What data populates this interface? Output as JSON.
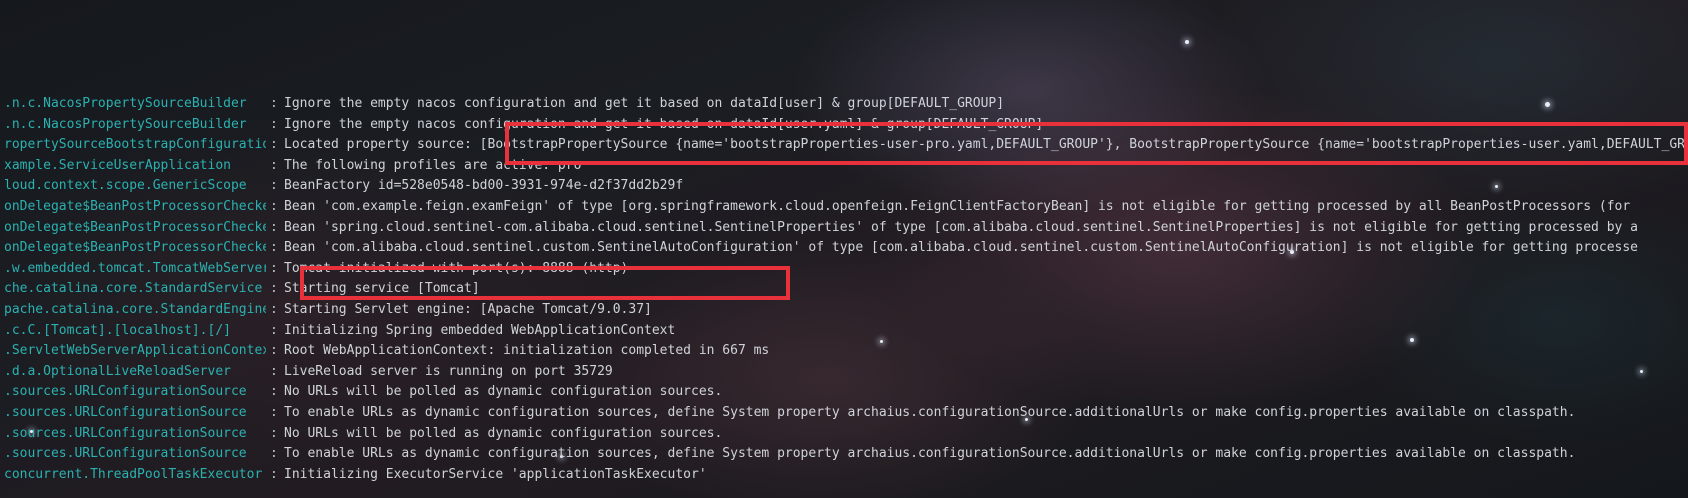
{
  "console": {
    "lines": [
      {
        "logger": ".n.c.NacosPropertySourceBuilder",
        "message": "Ignore the empty nacos configuration and get it based on dataId[user] & group[DEFAULT_GROUP]"
      },
      {
        "logger": ".n.c.NacosPropertySourceBuilder",
        "message": "Ignore the empty nacos configuration and get it based on dataId[user.yaml] & group[DEFAULT_GROUP]"
      },
      {
        "logger": "ropertySourceBootstrapConfiguration",
        "message": "Located property source: [BootstrapPropertySource {name='bootstrapProperties-user-pro.yaml,DEFAULT_GROUP'}, BootstrapPropertySource {name='bootstrapProperties-user.yaml,DEFAULT_GROUP'}"
      },
      {
        "logger": "xample.ServiceUserApplication",
        "message": "The following profiles are active: pro"
      },
      {
        "logger": "loud.context.scope.GenericScope",
        "message": "BeanFactory id=528e0548-bd00-3931-974e-d2f37dd2b29f"
      },
      {
        "logger": "onDelegate$BeanPostProcessorChecker",
        "message": "Bean 'com.example.feign.examFeign' of type [org.springframework.cloud.openfeign.FeignClientFactoryBean] is not eligible for getting processed by all BeanPostProcessors (for"
      },
      {
        "logger": "onDelegate$BeanPostProcessorChecker",
        "message": "Bean 'spring.cloud.sentinel-com.alibaba.cloud.sentinel.SentinelProperties' of type [com.alibaba.cloud.sentinel.SentinelProperties] is not eligible for getting processed by a"
      },
      {
        "logger": "onDelegate$BeanPostProcessorChecker",
        "message": "Bean 'com.alibaba.cloud.sentinel.custom.SentinelAutoConfiguration' of type [com.alibaba.cloud.sentinel.custom.SentinelAutoConfiguration] is not eligible for getting processe"
      },
      {
        "logger": ".w.embedded.tomcat.TomcatWebServer",
        "message": "Tomcat initialized with port(s): 8888 (http)"
      },
      {
        "logger": "che.catalina.core.StandardService",
        "message": "Starting service [Tomcat]"
      },
      {
        "logger": "pache.catalina.core.StandardEngine",
        "message": "Starting Servlet engine: [Apache Tomcat/9.0.37]"
      },
      {
        "logger": ".c.C.[Tomcat].[localhost].[/]",
        "message": "Initializing Spring embedded WebApplicationContext"
      },
      {
        "logger": ".ServletWebServerApplicationContext",
        "message": "Root WebApplicationContext: initialization completed in 667 ms"
      },
      {
        "logger": ".d.a.OptionalLiveReloadServer",
        "message": "LiveReload server is running on port 35729"
      },
      {
        "logger": ".sources.URLConfigurationSource",
        "message": "No URLs will be polled as dynamic configuration sources."
      },
      {
        "logger": ".sources.URLConfigurationSource",
        "message": "To enable URLs as dynamic configuration sources, define System property archaius.configurationSource.additionalUrls or make config.properties available on classpath."
      },
      {
        "logger": ".sources.URLConfigurationSource",
        "message": "No URLs will be polled as dynamic configuration sources."
      },
      {
        "logger": ".sources.URLConfigurationSource",
        "message": "To enable URLs as dynamic configuration sources, define System property archaius.configurationSource.additionalUrls or make config.properties available on classpath."
      },
      {
        "logger": "concurrent.ThreadPoolTaskExecutor",
        "message": "Initializing ExecutorService 'applicationTaskExecutor'"
      }
    ],
    "separator": ":"
  },
  "colors": {
    "logger_text": "#2bb1b0",
    "message_text": "#cfd3d9",
    "highlight_border": "#e8313a"
  }
}
